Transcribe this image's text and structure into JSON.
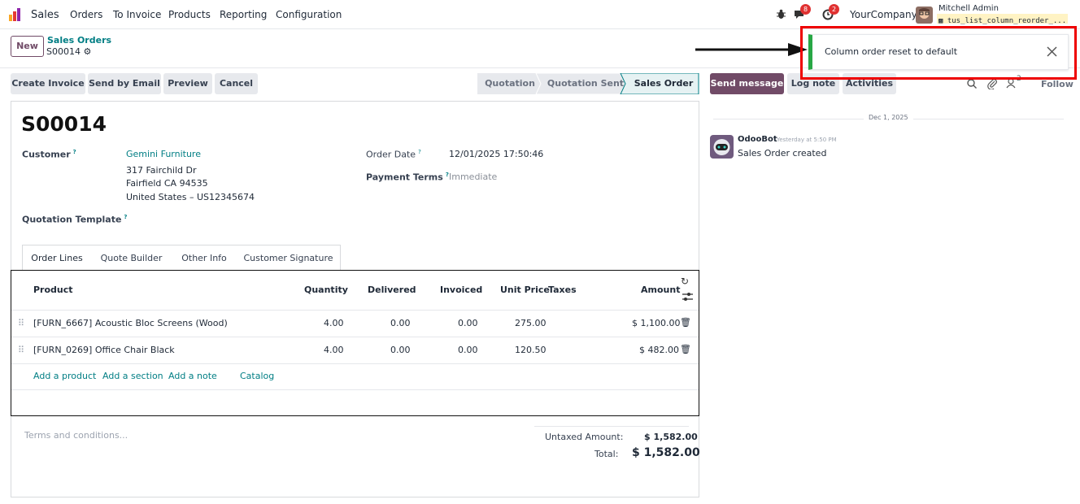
{
  "navbar": {
    "app_name": "Sales",
    "menus": [
      "Orders",
      "To Invoice",
      "Products",
      "Reporting",
      "Configuration"
    ],
    "messages_badge": "8",
    "activities_badge": "2",
    "company": "YourCompany",
    "user_name": "Mitchell Admin",
    "db_name": "tus_list_column_reorder_..."
  },
  "control": {
    "new_label": "New",
    "breadcrumb_parent": "Sales Orders",
    "breadcrumb_current": "S00014"
  },
  "actions": {
    "create_invoice": "Create Invoice",
    "send_email": "Send by Email",
    "preview": "Preview",
    "cancel": "Cancel"
  },
  "statusbar": [
    "Quotation",
    "Quotation Sent",
    "Sales Order"
  ],
  "form": {
    "title": "S00014",
    "customer_label": "Customer",
    "customer_name": "Gemini Furniture",
    "address_line1": "317 Fairchild Dr",
    "address_line2": "Fairfield CA 94535",
    "address_line3": "United States – US12345674",
    "quotation_template_label": "Quotation Template",
    "order_date_label": "Order Date",
    "order_date_value": "12/01/2025 17:50:46",
    "payment_terms_label": "Payment Terms",
    "payment_terms_value": "Immediate"
  },
  "tabs": [
    "Order Lines",
    "Quote Builder",
    "Other Info",
    "Customer Signature"
  ],
  "order_lines": {
    "columns": [
      "Product",
      "Quantity",
      "Delivered",
      "Invoiced",
      "Unit Price",
      "Taxes",
      "Amount"
    ],
    "rows": [
      {
        "product": "[FURN_6667] Acoustic Bloc Screens (Wood)",
        "quantity": "4.00",
        "delivered": "0.00",
        "invoiced": "0.00",
        "unit_price": "275.00",
        "taxes": "",
        "amount": "$ 1,100.00"
      },
      {
        "product": "[FURN_0269] Office Chair Black",
        "quantity": "4.00",
        "delivered": "0.00",
        "invoiced": "0.00",
        "unit_price": "120.50",
        "taxes": "",
        "amount": "$ 482.00"
      }
    ],
    "add_product": "Add a product",
    "add_section": "Add a section",
    "add_note": "Add a note",
    "catalog": "Catalog"
  },
  "footer": {
    "terms_placeholder": "Terms and conditions...",
    "untaxed_label": "Untaxed Amount:",
    "untaxed_value": "$ 1,582.00",
    "total_label": "Total:",
    "total_value": "$ 1,582.00"
  },
  "chatter": {
    "send_message": "Send message",
    "log_note": "Log note",
    "activities": "Activities",
    "followers_count": "2",
    "follow": "Follow",
    "date_separator": "Dec 1, 2025",
    "author": "OdooBot",
    "timestamp": "Yesterday at 5:50 PM",
    "message": "Sales Order created"
  },
  "notification": {
    "text": "Column order reset to default"
  },
  "colors": {
    "brand": "#714b67",
    "link": "#017e84",
    "success": "#28a745",
    "highlight": "#ee0000"
  }
}
